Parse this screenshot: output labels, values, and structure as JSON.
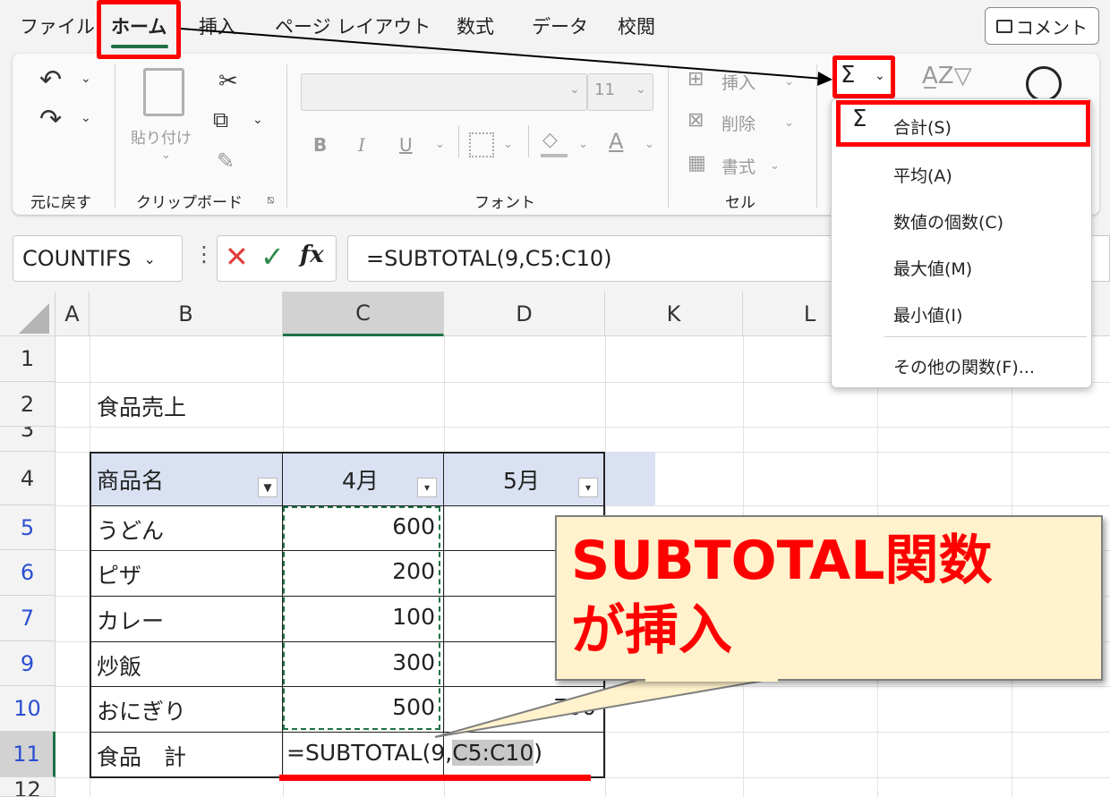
{
  "menu": {
    "tabs": [
      "ファイル",
      "ホーム",
      "挿入",
      "ページ レイアウト",
      "数式",
      "データ",
      "校閲"
    ],
    "comment_label": "コメント"
  },
  "ribbon": {
    "undo_label": "元に戻す",
    "clipboard_label": "クリップボード",
    "paste_label": "貼り付け",
    "font_label": "フォント",
    "font_size": "11",
    "cells_label": "セル",
    "insert_label": "挿入",
    "delete_label": "削除",
    "format_label": "書式",
    "sigma_symbol": "Σ"
  },
  "formula_bar": {
    "name_box": "COUNTIFS",
    "fx": "fx",
    "formula": "=SUBTOTAL(9,C5:C10)"
  },
  "sheet": {
    "columns": [
      "A",
      "B",
      "C",
      "D",
      "K",
      "L"
    ],
    "row_numbers": [
      "1",
      "2",
      "3",
      "4",
      "5",
      "6",
      "7",
      "9",
      "10",
      "11",
      "12"
    ],
    "title": "食品売上",
    "table_headers": [
      "商品名",
      "4月",
      "5月"
    ],
    "rows": [
      {
        "name": "うどん",
        "april": "600"
      },
      {
        "name": "ピザ",
        "april": "200"
      },
      {
        "name": "カレー",
        "april": "100"
      },
      {
        "name": "炒飯",
        "april": "300"
      },
      {
        "name": "おにぎり",
        "april": "500",
        "may_partial": "700"
      }
    ],
    "total_label": "食品　計",
    "total_formula_prefix": "=SUBTOTAL(9,",
    "total_formula_range": "C5:C10",
    "total_formula_suffix": ")"
  },
  "autosum_menu": {
    "items": [
      "合計(S)",
      "平均(A)",
      "数値の個数(C)",
      "最大値(M)",
      "最小値(I)",
      "その他の関数(F)..."
    ]
  },
  "callout": {
    "line1": "SUBTOTAL関数",
    "line2": "が挿入"
  },
  "colors": {
    "highlight": "#ff0000",
    "excel_green": "#1e7145",
    "table_header": "#d9e1f2",
    "callout_fill": "#fff2cc"
  }
}
